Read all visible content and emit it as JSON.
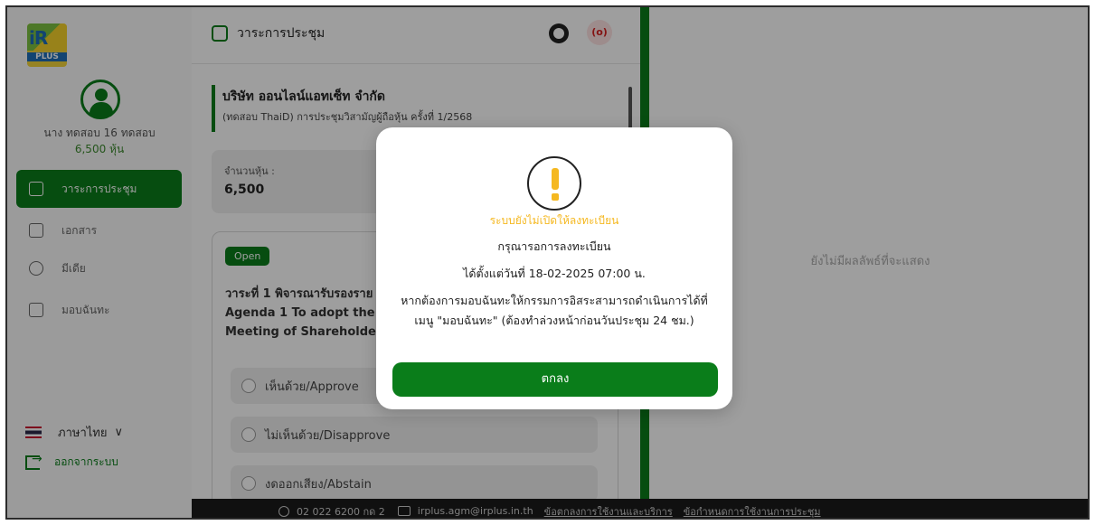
{
  "sidebar": {
    "logo_text": "iR",
    "logo_sub": "PLUS",
    "user_name": "นาง ทดสอบ 16 ทดสอบ",
    "user_shares": "6,500 หุ้น",
    "items": [
      {
        "label": "วาระการประชุม",
        "icon": "agenda-icon"
      },
      {
        "label": "เอกสาร",
        "icon": "folder-icon"
      },
      {
        "label": "มีเดีย",
        "icon": "play-icon"
      },
      {
        "label": "มอบฉันทะ",
        "icon": "proxy-icon"
      }
    ],
    "language": "ภาษาไทย",
    "language_chevron": "∨",
    "logout": "ออกจากระบบ"
  },
  "main": {
    "header_title": "วาระการประชุม",
    "live_label": "(o)",
    "company_name": "บริษัท ออนไลน์แอทเซ็ท จำกัด",
    "meeting_title": "(ทดสอบ ThaiD) การประชุมวิสามัญผู้ถือหุ้น ครั้งที่ 1/2568",
    "shares_label": "จำนวนหุ้น :",
    "shares_value": "6,500",
    "agenda": {
      "status": "Open",
      "line1": "วาระที่ 1 พิจารณารับรองราย",
      "line2": "Agenda 1 To adopt the N",
      "line3": "Meeting of Shareholders",
      "options": [
        "เห็นด้วย/Approve",
        "ไม่เห็นด้วย/Disapprove",
        "งดออกเสียง/Abstain"
      ]
    }
  },
  "right_panel": {
    "empty_text": "ยังไม่มีผลลัพธ์ที่จะแสดง"
  },
  "footer": {
    "phone": "02 022 6200 กด 2",
    "email": "irplus.agm@irplus.in.th",
    "link1": "ข้อตกลงการใช้งานและบริการ",
    "link2": "ข้อกำหนดการใช้งานการประชุม"
  },
  "modal": {
    "title": "ระบบยังไม่เปิดให้ลงทะเบียน",
    "line1": "กรุณารอการลงทะเบียน",
    "line2": "ได้ตั้งแต่วันที่ 18-02-2025 07:00 น.",
    "line3": "หากต้องการมอบฉันทะให้กรรมการอิสระสามารถดำเนินการได้ที่",
    "line4": "เมนู \"มอบฉันทะ\" (ต้องทำล่วงหน้าก่อนวันประชุม 24 ชม.)",
    "ok_label": "ตกลง"
  },
  "colors": {
    "brand_green": "#0a7d1a",
    "warning_yellow": "#f5b820"
  }
}
